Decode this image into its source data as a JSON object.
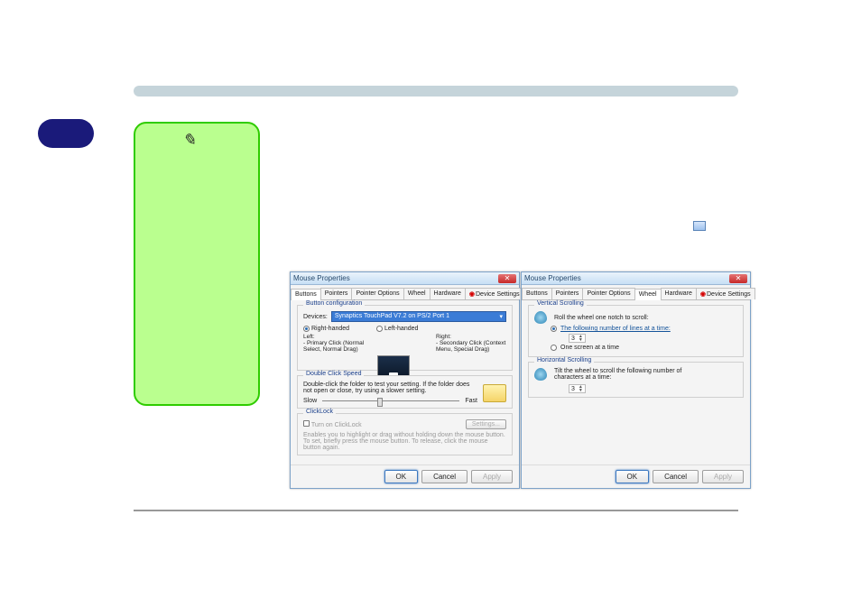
{
  "dialogTitle": "Mouse Properties",
  "tabs": [
    "Buttons",
    "Pointers",
    "Pointer Options",
    "Wheel",
    "Hardware",
    "Device Settings"
  ],
  "buttonsPanel": {
    "group1": {
      "title": "Button configuration",
      "deviceLabel": "Devices:",
      "deviceValue": "Synaptics TouchPad V7.2 on PS/2 Port 1",
      "rightHanded": "Right-handed",
      "leftHanded": "Left-handed",
      "leftTitle": "Left:",
      "leftDesc": "- Primary Click (Normal Select, Normal Drag)",
      "rightTitle": "Right:",
      "rightDesc": "- Secondary Click (Context Menu, Special Drag)"
    },
    "group2": {
      "title": "Double Click Speed",
      "desc": "Double-click the folder to test your setting. If the folder does not open or close, try using a slower setting.",
      "slow": "Slow",
      "fast": "Fast"
    },
    "group3": {
      "title": "ClickLock",
      "turnOn": "Turn on ClickLock",
      "settings": "Settings...",
      "desc": "Enables you to highlight or drag without holding down the mouse button. To set, briefly press the mouse button. To release, click the mouse button again."
    }
  },
  "wheelPanel": {
    "group1": {
      "title": "Vertical Scrolling",
      "line1": "Roll the wheel one notch to scroll:",
      "opt1": "The following number of lines at a time:",
      "value1": "3",
      "opt2": "One screen at a time"
    },
    "group2": {
      "title": "Horizontal Scrolling",
      "line1": "Tilt the wheel to scroll the following number of characters at a time:",
      "value1": "3"
    }
  },
  "buttons": {
    "ok": "OK",
    "cancel": "Cancel",
    "apply": "Apply"
  }
}
